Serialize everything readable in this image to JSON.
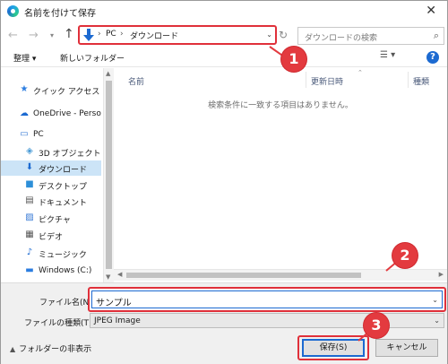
{
  "window": {
    "title": "名前を付けて保存"
  },
  "address": {
    "parts": [
      "PC",
      "ダウンロード"
    ]
  },
  "search": {
    "placeholder": "ダウンロードの検索"
  },
  "toolbar": {
    "organize_label": "整理 ▾",
    "new_folder_label": "新しいフォルダー",
    "view_icon": "view-toggle-icon",
    "help_label": "?"
  },
  "sidebar": {
    "items": [
      {
        "label": "クイック アクセス",
        "icon": "star-icon"
      },
      {
        "label": "OneDrive - Person",
        "icon": "cloud-icon"
      },
      {
        "label": "PC",
        "icon": "pc-icon"
      },
      {
        "label": "3D オブジェクト",
        "icon": "3d-objects-icon"
      },
      {
        "label": "ダウンロード",
        "icon": "download-icon",
        "selected": true
      },
      {
        "label": "デスクトップ",
        "icon": "desktop-icon"
      },
      {
        "label": "ドキュメント",
        "icon": "document-icon"
      },
      {
        "label": "ピクチャ",
        "icon": "picture-icon"
      },
      {
        "label": "ビデオ",
        "icon": "video-icon"
      },
      {
        "label": "ミュージック",
        "icon": "music-icon"
      },
      {
        "label": "Windows (C:)",
        "icon": "drive-icon"
      }
    ]
  },
  "files": {
    "columns": [
      "名前",
      "更新日時",
      "種類"
    ],
    "empty_message": "検索条件に一致する項目はありません。"
  },
  "form": {
    "filename_label": "ファイル名(N):",
    "filename_value": "サンプル",
    "filetype_label": "ファイルの種類(T):",
    "filetype_value": "JPEG Image",
    "hide_folders_label": "フォルダーの非表示",
    "save_label": "保存(S)",
    "cancel_label": "キャンセル"
  },
  "callouts": [
    "1",
    "2",
    "3"
  ],
  "colors": {
    "callout": "#e33a3f",
    "accent": "#1c6ad1",
    "selection": "#cce4f7"
  }
}
